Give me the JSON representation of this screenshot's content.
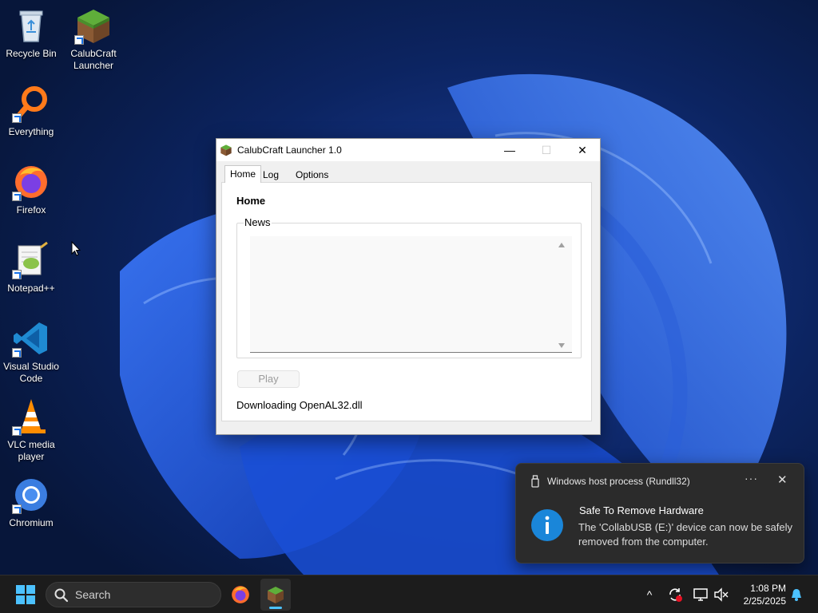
{
  "desktop": {
    "icons": [
      {
        "label": "Recycle Bin"
      },
      {
        "label": "CalubCraft Launcher"
      },
      {
        "label": "Everything"
      },
      {
        "label": "Firefox"
      },
      {
        "label": "Notepad++"
      },
      {
        "label": "Visual Studio Code"
      },
      {
        "label": "VLC media player"
      },
      {
        "label": "Chromium"
      }
    ]
  },
  "launcher": {
    "title": "CalubCraft Launcher 1.0",
    "controls": {
      "minimize": "—",
      "maximize": "☐",
      "close": "✕"
    },
    "tabs": [
      {
        "label": "Home",
        "active": true
      },
      {
        "label": "Log",
        "active": false
      },
      {
        "label": "Options",
        "active": false
      }
    ],
    "panel": {
      "heading": "Home",
      "news_label": "News",
      "news_content": "",
      "play_label": "Play",
      "play_enabled": false,
      "status": "Downloading OpenAL32.dll"
    }
  },
  "toast": {
    "source": "Windows host process (Rundll32)",
    "more": "···",
    "close": "✕",
    "headline": "Safe To Remove Hardware",
    "body": "The 'CollabUSB (E:)' device can now be safely removed from the computer."
  },
  "taskbar": {
    "search_label": "Search",
    "clock_time": "1:08 PM",
    "clock_date": "2/25/2025",
    "tray_chevron": "^",
    "accent": "#4cc2ff"
  }
}
